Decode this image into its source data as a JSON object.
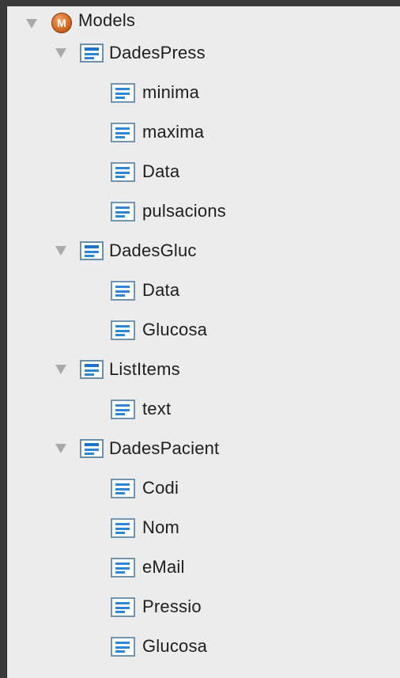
{
  "tree": {
    "root": {
      "label": "Models",
      "icon": "model-m-icon",
      "icon_letter": "M",
      "expanded": true
    },
    "entities": [
      {
        "label": "DadesPress",
        "expanded": true,
        "properties": [
          "minima",
          "maxima",
          "Data",
          "pulsacions"
        ]
      },
      {
        "label": "DadesGluc",
        "expanded": true,
        "properties": [
          "Data",
          "Glucosa"
        ]
      },
      {
        "label": "ListItems",
        "expanded": true,
        "properties": [
          "text"
        ]
      },
      {
        "label": "DadesPacient",
        "expanded": true,
        "properties": [
          "Codi",
          "Nom",
          "eMail",
          "Pressio",
          "Glucosa"
        ]
      }
    ]
  },
  "colors": {
    "panel_background": "#ececec",
    "outer_background": "#3b3b3b",
    "icon_blue": "#2e86d6",
    "model_icon_orange": "#d66b25",
    "twisty_gray": "#a9a9a9"
  }
}
